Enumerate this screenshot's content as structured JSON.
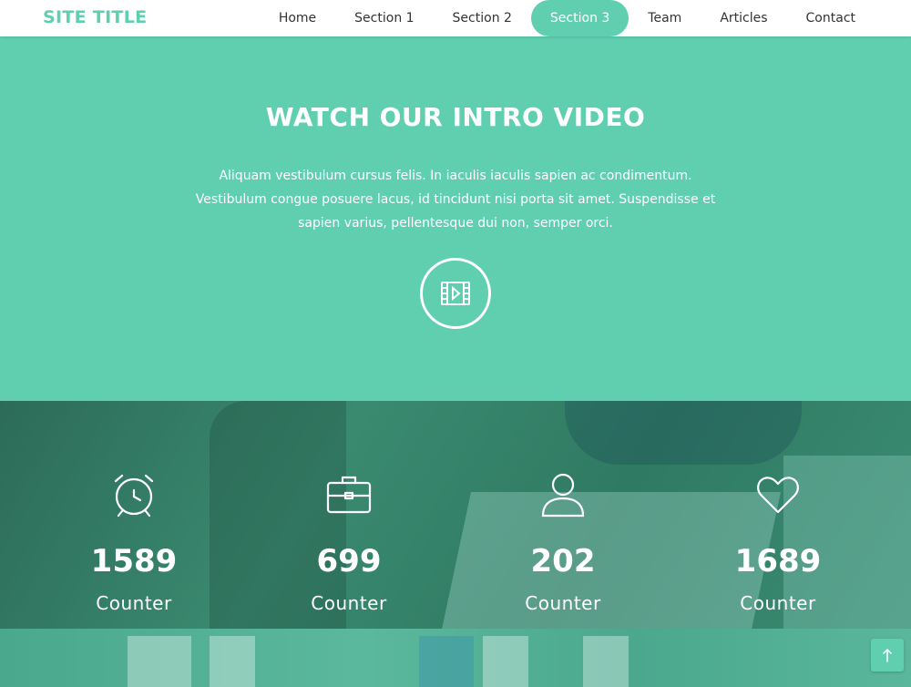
{
  "brand": {
    "title": "SITE TITLE"
  },
  "nav": {
    "items": [
      {
        "label": "Home"
      },
      {
        "label": "Section 1"
      },
      {
        "label": "Section 2"
      },
      {
        "label": "Section 3"
      },
      {
        "label": "Team"
      },
      {
        "label": "Articles"
      },
      {
        "label": "Contact"
      }
    ],
    "active": "Section 3"
  },
  "intro": {
    "heading": "WATCH OUR INTRO VIDEO",
    "text": "Aliquam vestibulum cursus felis. In iaculis iaculis sapien ac condimentum. Vestibulum congue posuere lacus, id tincidunt nisi porta sit amet. Suspendisse et sapien varius, pellentesque dui non, semper orci.",
    "play_icon": "video-play-icon"
  },
  "counters": [
    {
      "icon": "alarm-clock-icon",
      "value": "1589",
      "label": "Counter"
    },
    {
      "icon": "briefcase-icon",
      "value": "699",
      "label": "Counter"
    },
    {
      "icon": "user-icon",
      "value": "202",
      "label": "Counter"
    },
    {
      "icon": "heart-icon",
      "value": "1689",
      "label": "Counter"
    }
  ],
  "colors": {
    "accent": "#5fcfb0",
    "overlay": "#2f7a62"
  },
  "scroll_top_icon": "arrow-up-icon"
}
